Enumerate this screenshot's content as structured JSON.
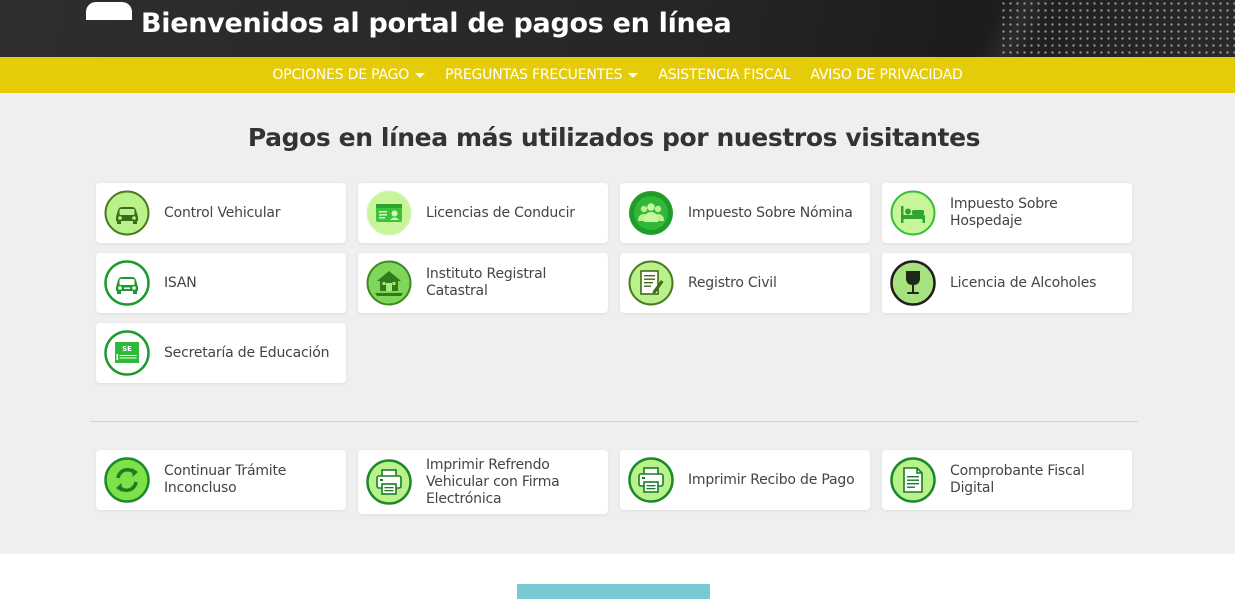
{
  "header": {
    "title": "Bienvenidos al portal de pagos en línea"
  },
  "nav": {
    "items": [
      {
        "label": "OPCIONES DE PAGO",
        "dropdown": true
      },
      {
        "label": "PREGUNTAS FRECUENTES",
        "dropdown": true
      },
      {
        "label": "ASISTENCIA FISCAL",
        "dropdown": false
      },
      {
        "label": "AVISO DE PRIVACIDAD",
        "dropdown": false
      }
    ]
  },
  "main": {
    "title": "Pagos en línea más utilizados por nuestros visitantes",
    "popular": [
      {
        "label": "Control Vehicular",
        "icon": "car-icon"
      },
      {
        "label": "Licencias de Conducir",
        "icon": "license-card-icon"
      },
      {
        "label": "Impuesto Sobre Nómina",
        "icon": "people-group-icon"
      },
      {
        "label": "Impuesto Sobre Hospedaje",
        "icon": "bed-icon"
      },
      {
        "label": "ISAN",
        "icon": "new-car-icon"
      },
      {
        "label": "Instituto Registral Catastral",
        "icon": "house-icon"
      },
      {
        "label": "Registro Civil",
        "icon": "document-pen-icon"
      },
      {
        "label": "Licencia de Alcoholes",
        "icon": "wine-glass-icon"
      },
      {
        "label": "Secretaría de Educación",
        "icon": "se-logo-icon",
        "icon_text": "SE"
      }
    ],
    "services": [
      {
        "label": "Continuar Trámite Inconcluso",
        "icon": "refresh-arrows-icon"
      },
      {
        "label": "Imprimir Refrendo Vehicular con Firma Electrónica",
        "icon": "printer-icon"
      },
      {
        "label": "Imprimir Recibo de Pago",
        "icon": "printer-icon"
      },
      {
        "label": "Comprobante Fiscal Digital",
        "icon": "invoice-document-icon"
      }
    ]
  },
  "colors": {
    "header_bg": "#262626",
    "nav_bg": "#e5cc0b",
    "main_bg": "#efefef",
    "icon_green": "#2f9e2f",
    "icon_light_green": "#b9f28a",
    "accent_cyan": "#79c9d4"
  }
}
